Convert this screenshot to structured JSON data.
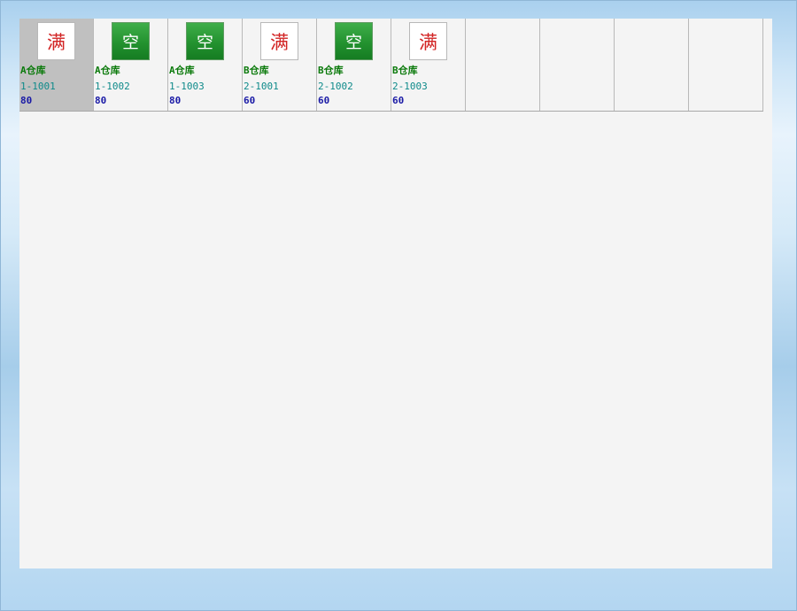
{
  "grid": {
    "cells": [
      {
        "status": "满",
        "warehouse": "A仓库",
        "code": "1-1001",
        "value": "80"
      },
      {
        "status": "空",
        "warehouse": "A仓库",
        "code": "1-1002",
        "value": "80"
      },
      {
        "status": "空",
        "warehouse": "A仓库",
        "code": "1-1003",
        "value": "80"
      },
      {
        "status": "满",
        "warehouse": "B仓库",
        "code": "2-1001",
        "value": "60"
      },
      {
        "status": "空",
        "warehouse": "B仓库",
        "code": "2-1002",
        "value": "60"
      },
      {
        "status": "满",
        "warehouse": "B仓库",
        "code": "2-1003",
        "value": "60"
      }
    ],
    "selected_index": 0,
    "empty_slots": 4
  },
  "colors": {
    "full_text": "#d22424",
    "empty_tile": "#23922f",
    "warehouse_text": "#0b7a0b",
    "code_text": "#0e8a8a",
    "value_text": "#1a1aa6"
  },
  "icons": {
    "full": "full-status-icon",
    "empty": "empty-status-icon"
  }
}
